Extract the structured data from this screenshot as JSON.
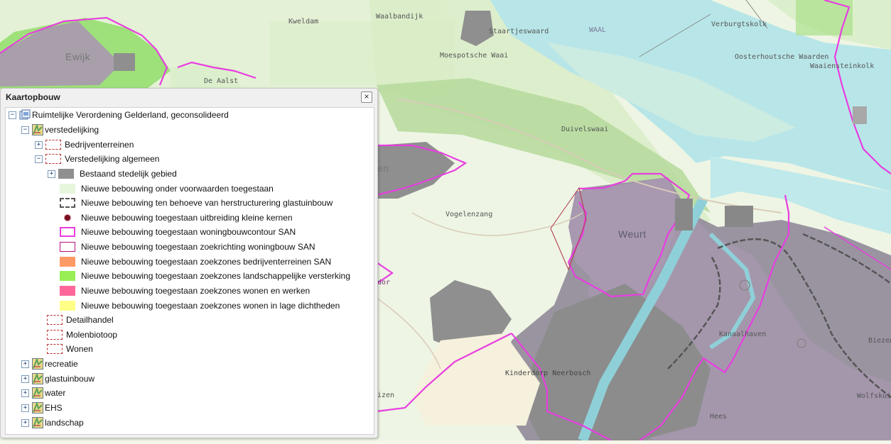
{
  "map": {
    "place_names": [
      {
        "id": "ewijk",
        "text": "Ewijk",
        "style": "big"
      },
      {
        "id": "kweldam",
        "text": "Kweldam"
      },
      {
        "id": "waalbandijk",
        "text": "Waalbandijk"
      },
      {
        "id": "staartjeswaard",
        "text": "Staartjeswaard"
      },
      {
        "id": "waal",
        "text": "WAAL",
        "style": "blue"
      },
      {
        "id": "verburgtskolk",
        "text": "Verburgtskolk"
      },
      {
        "id": "moespotsche-waai",
        "text": "Moespotsche Waai"
      },
      {
        "id": "oosterhoutsche-waarden",
        "text": "Oosterhoutsche Waarden"
      },
      {
        "id": "waaiensteinkolk",
        "text": "Waaiensteinkolk"
      },
      {
        "id": "de-aalst",
        "text": "De Aalst"
      },
      {
        "id": "duivelswaai",
        "text": "Duivelswaai"
      },
      {
        "id": "vogelenzang",
        "text": "Vogelenzang"
      },
      {
        "id": "weurt",
        "text": "Weurt",
        "style": "big"
      },
      {
        "id": "kanaalhaven",
        "text": "Kanaalhaven"
      },
      {
        "id": "kinderdorp",
        "text": "Kinderdorp Neerbosch"
      },
      {
        "id": "hees",
        "text": "Hees"
      },
      {
        "id": "wolfskuil",
        "text": "Wolfskuil"
      },
      {
        "id": "biezen",
        "text": "Biezen"
      },
      {
        "id": "en-partial",
        "text": "en"
      },
      {
        "id": "dor-partial",
        "text": "dor"
      },
      {
        "id": "izen-partial",
        "text": "izen"
      }
    ]
  },
  "panel": {
    "title": "Kaartopbouw",
    "close_label": "×",
    "tree": [
      {
        "id": "root",
        "label": "Ruimtelijke Verordening Gelderland, geconsolideerd",
        "toggle": "−",
        "icon": "service-icon"
      },
      {
        "id": "verstedelijking",
        "label": "verstedelijking",
        "toggle": "−",
        "icon": "layer-icon"
      },
      {
        "id": "bedrijventerreinen",
        "label": "Bedrijventerreinen",
        "toggle": "+",
        "symbol": "dashed-red"
      },
      {
        "id": "verstedelijking-algemeen",
        "label": "Verstedelijking algemeen",
        "toggle": "−",
        "symbol": "dashed-red"
      },
      {
        "id": "bestaand-stedelijk",
        "label": "Bestaand stedelijk gebied",
        "toggle": "+",
        "symbol": "fill-gray"
      },
      {
        "id": "nb-voorwaarden",
        "label": "Nieuwe bebouwing onder voorwaarden toegestaan",
        "symbol": "fill-palegreen"
      },
      {
        "id": "nb-glastuinbouw",
        "label": "Nieuwe bebouwing ten behoeve van herstructurering glastuinbouw",
        "symbol": "dashed-gray"
      },
      {
        "id": "nb-kleine-kernen",
        "label": "Nieuwe bebouwing toegestaan uitbreiding kleine kernen",
        "symbol": "dot-darkred"
      },
      {
        "id": "nb-woningbouwcontour",
        "label": "Nieuwe bebouwing toegestaan woningbouwcontour SAN",
        "symbol": "outline-magenta-thick"
      },
      {
        "id": "nb-zoekrichting",
        "label": "Nieuwe bebouwing toegestaan zoekrichting woningbouw SAN",
        "symbol": "outline-magenta-thin"
      },
      {
        "id": "nb-bedrijventerreinen",
        "label": "Nieuwe bebouwing toegestaan zoekzones bedrijventerreinen SAN",
        "symbol": "fill-orange"
      },
      {
        "id": "nb-landschap",
        "label": "Nieuwe bebouwing toegestaan zoekzones landschappelijke versterking",
        "symbol": "fill-lightgreen"
      },
      {
        "id": "nb-wonen-werken",
        "label": "Nieuwe bebouwing toegestaan zoekzones wonen en werken",
        "symbol": "fill-pink"
      },
      {
        "id": "nb-lage-dichtheden",
        "label": "Nieuwe bebouwing toegestaan zoekzones wonen in lage dichtheden",
        "symbol": "fill-yellow"
      },
      {
        "id": "detailhandel",
        "label": "Detailhandel",
        "symbol": "dashed-red"
      },
      {
        "id": "molenbiotoop",
        "label": "Molenbiotoop",
        "symbol": "dashed-red"
      },
      {
        "id": "wonen",
        "label": "Wonen",
        "symbol": "dashed-red"
      },
      {
        "id": "recreatie",
        "label": "recreatie",
        "toggle": "+",
        "icon": "layer-icon"
      },
      {
        "id": "glastuinbouw",
        "label": "glastuinbouw",
        "toggle": "+",
        "icon": "layer-icon"
      },
      {
        "id": "water",
        "label": "water",
        "toggle": "+",
        "icon": "layer-icon"
      },
      {
        "id": "ehs",
        "label": "EHS",
        "toggle": "+",
        "icon": "layer-icon"
      },
      {
        "id": "landschap",
        "label": "landschap",
        "toggle": "+",
        "icon": "layer-icon"
      }
    ]
  },
  "colors": {
    "river": "#b8e6e8",
    "urban": "#8f8f8f",
    "urban_purple": "#a898b0",
    "green_strip": "#b8dca0",
    "bright_green": "#9ee07a",
    "magenta": "#e83ee0",
    "land": "#eef5e4"
  }
}
